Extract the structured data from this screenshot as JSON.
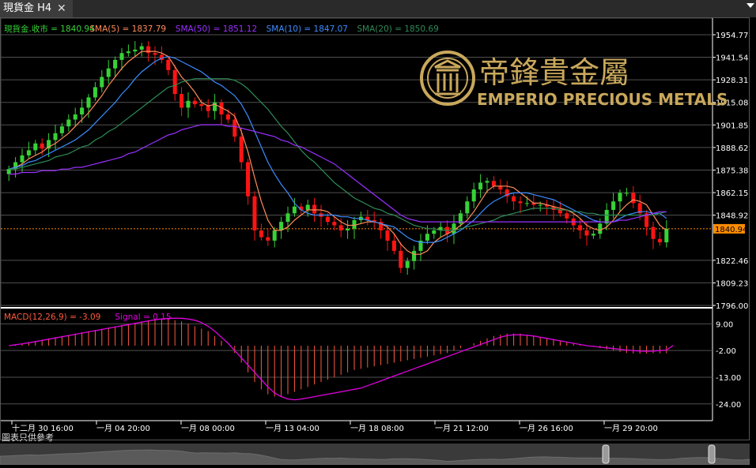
{
  "tab": {
    "title": "現貨金 H4",
    "close_symbol": "✕"
  },
  "legend": {
    "items": [
      {
        "label": "現貨金.收市 = 1840.94",
        "color": "#36d236"
      },
      {
        "label": "SMA(5) = 1837.79",
        "color": "#ff8c5a"
      },
      {
        "label": "SMA(50) = 1851.12",
        "color": "#9b30ff"
      },
      {
        "label": "SMA(10) = 1847.07",
        "color": "#3c8cff"
      },
      {
        "label": "SMA(20) = 1850.69",
        "color": "#2e8b57"
      }
    ]
  },
  "macd_legend": {
    "items": [
      {
        "label": "MACD(12,26,9) = -3.09",
        "color": "#ff5a3c"
      },
      {
        "label": "Signal = 0.15",
        "color": "#e000e0"
      }
    ]
  },
  "logo": {
    "chinese": "帝鋒貴金屬",
    "english": "EMPERIO PRECIOUS METALS",
    "color": "#c9a85c"
  },
  "footer_label": "圖表只供參考",
  "price_axis": {
    "ticks": [
      "1954.77",
      "1941.54",
      "1928.31",
      "1915.08",
      "1901.85",
      "1888.62",
      "1875.38",
      "1862.15",
      "1848.92",
      "1822.46",
      "1809.23",
      "1796.00"
    ],
    "current": "1840.94"
  },
  "macd_axis": {
    "ticks": [
      "9.00",
      "-2.00",
      "-13.00",
      "-24.00"
    ]
  },
  "time_axis": {
    "ticks": [
      "十二月 30 16:00",
      "一月 04 20:00",
      "一月 08 00:00",
      "一月 13 04:00",
      "一月 18 08:00",
      "一月 21 12:00",
      "一月 26 16:00",
      "一月 29 20:00"
    ]
  },
  "colors": {
    "up": "#36d236",
    "down": "#ff1414",
    "grid": "#505050",
    "axis_text": "#ffffff"
  },
  "chart_data": [
    {
      "type": "candlestick",
      "title": "現貨金 H4",
      "ylim": [
        1796.0,
        1958.0
      ],
      "x_ticks": [
        "十二月 30 16:00",
        "一月 04 20:00",
        "一月 08 00:00",
        "一月 13 04:00",
        "一月 18 08:00",
        "一月 21 12:00",
        "一月 26 16:00",
        "一月 29 20:00"
      ],
      "close": [
        1876,
        1880,
        1884,
        1887,
        1891,
        1888,
        1893,
        1897,
        1901,
        1905,
        1908,
        1912,
        1918,
        1924,
        1930,
        1935,
        1940,
        1944,
        1945,
        1946,
        1948,
        1944,
        1943,
        1940,
        1934,
        1920,
        1912,
        1916,
        1914,
        1913,
        1910,
        1915,
        1908,
        1905,
        1895,
        1880,
        1860,
        1840,
        1836,
        1834,
        1840,
        1845,
        1850,
        1854,
        1852,
        1855,
        1850,
        1848,
        1845,
        1843,
        1840,
        1841,
        1846,
        1848,
        1846,
        1845,
        1840,
        1834,
        1828,
        1818,
        1822,
        1828,
        1834,
        1838,
        1840,
        1842,
        1838,
        1844,
        1850,
        1857,
        1864,
        1868,
        1869,
        1866,
        1864,
        1860,
        1857,
        1856,
        1856,
        1855,
        1855,
        1854,
        1852,
        1850,
        1847,
        1843,
        1840,
        1837,
        1838,
        1844,
        1852,
        1857,
        1862,
        1862,
        1856,
        1850,
        1842,
        1835,
        1833,
        1841
      ],
      "series": [
        {
          "name": "SMA(5)",
          "values": [
            1876,
            1877,
            1879,
            1882,
            1884,
            1886,
            1889,
            1891,
            1894,
            1897,
            1901,
            1905,
            1909,
            1914,
            1919,
            1925,
            1930,
            1935,
            1939,
            1942,
            1945,
            1945,
            1945,
            1944,
            1942,
            1936,
            1930,
            1926,
            1921,
            1915,
            1913,
            1914,
            1912,
            1910,
            1907,
            1898,
            1886,
            1871,
            1857,
            1846,
            1840,
            1840,
            1842,
            1846,
            1849,
            1852,
            1852,
            1852,
            1851,
            1848,
            1845,
            1843,
            1843,
            1844,
            1845,
            1845,
            1844,
            1842,
            1838,
            1832,
            1828,
            1826,
            1826,
            1828,
            1833,
            1836,
            1838,
            1840,
            1843,
            1846,
            1851,
            1857,
            1863,
            1866,
            1866,
            1866,
            1865,
            1862,
            1859,
            1856,
            1856,
            1855,
            1854,
            1853,
            1852,
            1850,
            1847,
            1843,
            1841,
            1840,
            1842,
            1846,
            1851,
            1855,
            1858,
            1857,
            1855,
            1849,
            1843,
            1840
          ]
        },
        {
          "name": "SMA(10)",
          "values": [
            1876,
            1877,
            1878,
            1880,
            1881,
            1883,
            1885,
            1887,
            1889,
            1891,
            1893,
            1896,
            1899,
            1903,
            1907,
            1911,
            1915,
            1920,
            1924,
            1929,
            1933,
            1936,
            1939,
            1941,
            1942,
            1941,
            1939,
            1937,
            1935,
            1933,
            1930,
            1927,
            1925,
            1922,
            1919,
            1914,
            1907,
            1898,
            1889,
            1880,
            1873,
            1867,
            1862,
            1856,
            1852,
            1850,
            1849,
            1849,
            1849,
            1849,
            1848,
            1848,
            1847,
            1847,
            1846,
            1845,
            1844,
            1843,
            1842,
            1839,
            1836,
            1834,
            1833,
            1833,
            1833,
            1834,
            1836,
            1838,
            1840,
            1843,
            1846,
            1850,
            1854,
            1857,
            1859,
            1861,
            1862,
            1862,
            1862,
            1861,
            1860,
            1859,
            1858,
            1856,
            1854,
            1852,
            1850,
            1848,
            1846,
            1845,
            1845,
            1845,
            1847,
            1849,
            1850,
            1851,
            1851,
            1850,
            1850,
            1847
          ]
        },
        {
          "name": "SMA(20)",
          "values": [
            1876,
            1876,
            1877,
            1878,
            1879,
            1880,
            1881,
            1883,
            1884,
            1885,
            1887,
            1889,
            1890,
            1893,
            1895,
            1898,
            1900,
            1903,
            1906,
            1909,
            1912,
            1915,
            1918,
            1921,
            1924,
            1925,
            1927,
            1928,
            1929,
            1929,
            1929,
            1929,
            1929,
            1929,
            1928,
            1926,
            1923,
            1919,
            1915,
            1911,
            1906,
            1901,
            1897,
            1892,
            1887,
            1883,
            1880,
            1876,
            1872,
            1868,
            1865,
            1862,
            1859,
            1857,
            1855,
            1853,
            1852,
            1850,
            1849,
            1847,
            1845,
            1843,
            1842,
            1841,
            1841,
            1840,
            1840,
            1840,
            1841,
            1842,
            1843,
            1844,
            1845,
            1846,
            1848,
            1849,
            1850,
            1851,
            1852,
            1853,
            1853,
            1853,
            1853,
            1852,
            1852,
            1851,
            1851,
            1850,
            1850,
            1849,
            1849,
            1849,
            1849,
            1849,
            1849,
            1849,
            1849,
            1849,
            1850,
            1851
          ]
        },
        {
          "name": "SMA(50)",
          "values": [
            1873,
            1873,
            1874,
            1874,
            1874,
            1875,
            1875,
            1875,
            1876,
            1876,
            1877,
            1877,
            1878,
            1879,
            1880,
            1881,
            1882,
            1883,
            1885,
            1886,
            1888,
            1890,
            1892,
            1894,
            1896,
            1897,
            1899,
            1900,
            1901,
            1902,
            1902,
            1902,
            1902,
            1901,
            1901,
            1900,
            1899,
            1898,
            1897,
            1896,
            1895,
            1893,
            1892,
            1890,
            1889,
            1887,
            1885,
            1883,
            1881,
            1879,
            1876,
            1873,
            1870,
            1867,
            1864,
            1861,
            1858,
            1855,
            1852,
            1849,
            1847,
            1846,
            1845,
            1845,
            1845,
            1845,
            1845,
            1845,
            1845,
            1845,
            1845,
            1845,
            1845,
            1845,
            1845,
            1845,
            1845,
            1845,
            1845,
            1845,
            1845,
            1845,
            1845,
            1845,
            1845,
            1845,
            1845,
            1845,
            1845,
            1845,
            1845,
            1845,
            1846,
            1846,
            1847,
            1848,
            1849,
            1850,
            1851,
            1851
          ]
        }
      ]
    },
    {
      "type": "bar",
      "title": "MACD(12,26,9)",
      "ylim": [
        -27,
        14
      ],
      "series": [
        {
          "name": "MACD(12,26,9)",
          "values": [
            0,
            0.5,
            1,
            1.5,
            2,
            2.5,
            3,
            3.5,
            4,
            4.5,
            5,
            5.5,
            6,
            6.5,
            7,
            7.5,
            8,
            8.5,
            9,
            9.5,
            10,
            10.5,
            11,
            11,
            11,
            10.5,
            10,
            9,
            8,
            7,
            6,
            4,
            2,
            0,
            -3,
            -7,
            -11,
            -15,
            -18,
            -20,
            -21,
            -21,
            -20,
            -19,
            -18,
            -17,
            -16,
            -15,
            -14,
            -13,
            -12,
            -11,
            -10,
            -9.5,
            -9,
            -8.5,
            -8,
            -7.5,
            -7,
            -6.5,
            -6,
            -5.5,
            -5,
            -4.5,
            -4,
            -3.5,
            -3,
            -2,
            -1,
            0,
            1,
            2,
            3,
            4,
            4.5,
            5,
            5,
            5,
            4.5,
            4,
            3.5,
            3,
            2.5,
            2,
            1.5,
            1,
            0.5,
            0,
            -0.5,
            -1,
            -1.5,
            -2,
            -2.5,
            -3,
            -3.2,
            -3.3,
            -3.2,
            -3.1,
            -3.1,
            -3.09
          ]
        },
        {
          "name": "Signal",
          "values": [
            0,
            0.4,
            0.8,
            1.2,
            1.7,
            2.2,
            2.7,
            3.2,
            3.7,
            4.2,
            4.7,
            5.2,
            5.7,
            6.2,
            6.7,
            7.2,
            7.7,
            8.2,
            8.7,
            9.2,
            9.7,
            10.2,
            10.7,
            11,
            11.3,
            11.3,
            11.3,
            11,
            10.5,
            9.5,
            8,
            6,
            3.5,
            1,
            -2,
            -5,
            -8,
            -11,
            -14,
            -17,
            -19.5,
            -21,
            -22,
            -22.3,
            -22,
            -21.5,
            -21,
            -20.5,
            -20,
            -19.5,
            -19,
            -18.5,
            -18,
            -17.5,
            -16.5,
            -15.5,
            -14.5,
            -13.5,
            -12.5,
            -11.5,
            -10.5,
            -9.5,
            -8.5,
            -7.5,
            -6.5,
            -5.5,
            -4.5,
            -3.5,
            -2.5,
            -1.5,
            -0.5,
            0.5,
            1.5,
            2.5,
            3.5,
            4.2,
            4.5,
            4.5,
            4.3,
            4,
            3.5,
            3,
            2.5,
            2,
            1.5,
            1,
            0.5,
            0,
            -0.3,
            -0.6,
            -0.9,
            -1.2,
            -1.5,
            -1.8,
            -2.0,
            -2.2,
            -2.3,
            -2.2,
            -2.0,
            -1.8,
            0.15
          ]
        }
      ]
    }
  ]
}
